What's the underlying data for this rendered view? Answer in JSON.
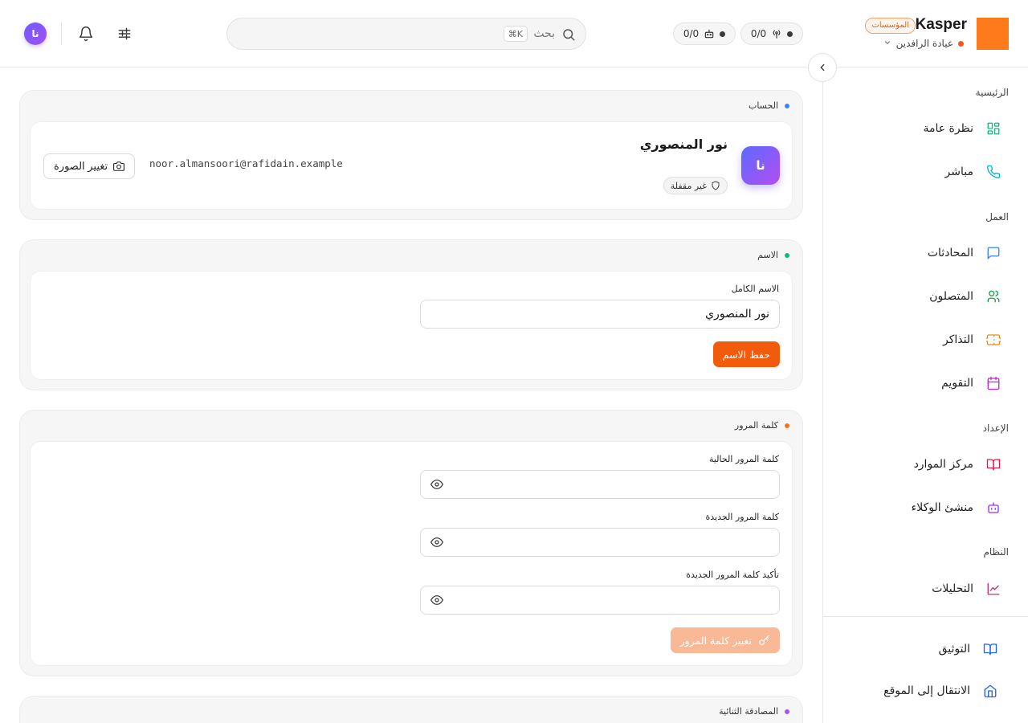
{
  "header": {
    "user_initials": "نا",
    "search": {
      "placeholder": "بحث",
      "shortcut": "⌘K"
    },
    "counters": [
      {
        "value": "0/0"
      },
      {
        "value": "0/0"
      }
    ],
    "brand": {
      "name": "Kasper",
      "tier_badge": "المؤسسات",
      "organization": "عيادة الرافدين"
    }
  },
  "sidebar": {
    "sections": {
      "home": "الرئيسية",
      "work": "العمل",
      "setup": "الإعداد",
      "system": "النظام"
    },
    "items": [
      {
        "label": "نظرة عامة",
        "icon": "grid-icon"
      },
      {
        "label": "مباشر",
        "icon": "phone-icon"
      },
      {
        "label": "المحادثات",
        "icon": "chat-icon"
      },
      {
        "label": "المتصلون",
        "icon": "users-icon"
      },
      {
        "label": "التذاكر",
        "icon": "ticket-icon"
      },
      {
        "label": "التقويم",
        "icon": "calendar-icon"
      },
      {
        "label": "مركز الموارد",
        "icon": "book-icon"
      },
      {
        "label": "منشئ الوكلاء",
        "icon": "bot-icon"
      },
      {
        "label": "التحليلات",
        "icon": "chart-icon"
      }
    ],
    "footer": [
      {
        "label": "التوثيق",
        "icon": "docs-icon"
      },
      {
        "label": "الانتقال إلى الموقع",
        "icon": "home-icon"
      }
    ]
  },
  "account": {
    "title": "الحساب",
    "name": "نور المنصوري",
    "initials": "نا",
    "status_badge": "غير مقفلة",
    "email": "noor.almansoori@rafidain.example",
    "change_photo_label": "تغيير الصورة"
  },
  "name_section": {
    "title": "الاسم",
    "full_name_label": "الاسم الكامل",
    "full_name_value": "نور المنصوري",
    "save_label": "حفظ الاسم"
  },
  "password_section": {
    "title": "كلمة المرور",
    "current_label": "كلمة المرور الحالية",
    "new_label": "كلمة المرور الجديدة",
    "confirm_label": "تأكيد كلمة المرور الجديدة",
    "submit_label": "تغيير كلمة المرور"
  },
  "twofa_section": {
    "title": "المصادقة الثنائية"
  },
  "colors": {
    "accent": "#f25a0c",
    "account_dot": "#3b82f6",
    "name_dot": "#10b981",
    "password_dot": "#f97316",
    "twofa_dot": "#a855f7"
  }
}
